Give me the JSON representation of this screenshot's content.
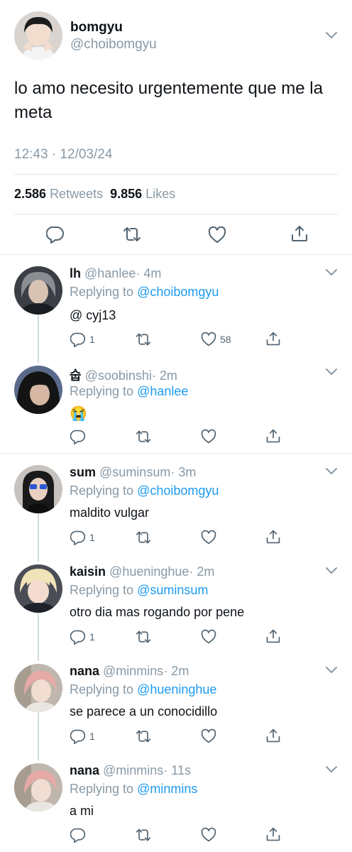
{
  "main_tweet": {
    "name": "bomgyu",
    "handle": "@choibomgyu",
    "text": "lo amo necesito urgentemente que me la meta",
    "time": "12:43 · 12/03/24",
    "retweets_count": "2.586",
    "retweets_label": "Retweets",
    "likes_count": "9.856",
    "likes_label": "Likes"
  },
  "replies": [
    {
      "name": "lh",
      "handle": "@hanlee",
      "time": "· 4m",
      "replying_prefix": "Replying to",
      "replying_to": "@choibomgyu",
      "text": "@ cyj13",
      "reply_count": "1",
      "like_count": "58"
    },
    {
      "name": "숩",
      "handle": "@soobinshi",
      "time": "· 2m",
      "replying_prefix": "Replying to",
      "replying_to": "@hanlee",
      "text": "😭",
      "reply_count": "",
      "like_count": ""
    },
    {
      "name": "sum",
      "handle": "@suminsum",
      "time": "· 3m",
      "replying_prefix": "Replying to",
      "replying_to": "@choibomgyu",
      "text": "maldito vulgar",
      "reply_count": "1",
      "like_count": ""
    },
    {
      "name": "kaisin",
      "handle": "@hueninghue",
      "time": "· 2m",
      "replying_prefix": "Replying to",
      "replying_to": "@suminsum",
      "text": "otro dia mas rogando por pene",
      "reply_count": "1",
      "like_count": ""
    },
    {
      "name": "nana",
      "handle": "@minmins",
      "time": "· 2m",
      "replying_prefix": "Replying to",
      "replying_to": "@hueninghue",
      "text": "se parece a un conocidillo",
      "reply_count": "1",
      "like_count": ""
    },
    {
      "name": "nana",
      "handle": "@minmins",
      "time": "· 11s",
      "replying_prefix": "Replying to",
      "replying_to": "@minmins",
      "text": "a mi",
      "reply_count": "",
      "like_count": ""
    }
  ],
  "icons": {
    "reply": "reply-icon",
    "retweet": "retweet-icon",
    "like": "heart-icon",
    "share": "share-icon",
    "more": "chevron-down-icon"
  },
  "colors": {
    "link": "#1d9bf0",
    "muted": "#8899a6",
    "divider": "#e1e8ed"
  }
}
